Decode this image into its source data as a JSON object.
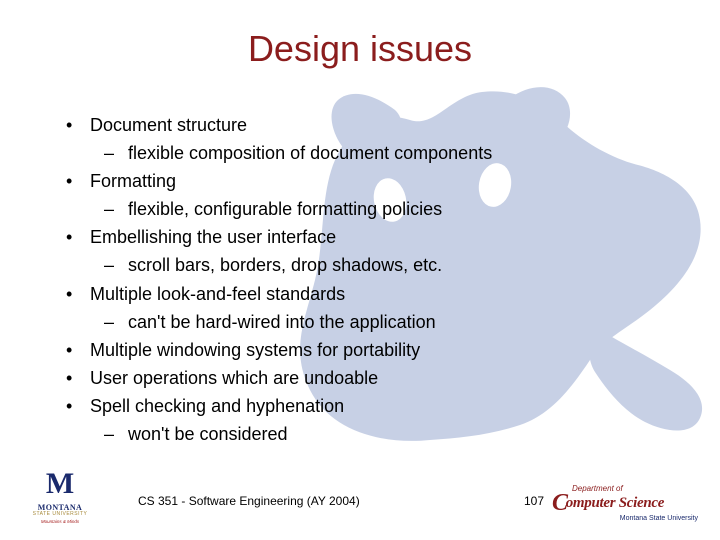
{
  "title": "Design issues",
  "bullets": [
    {
      "level": 1,
      "text": "Document structure"
    },
    {
      "level": 2,
      "text": "flexible composition of document components"
    },
    {
      "level": 1,
      "text": "Formatting"
    },
    {
      "level": 2,
      "text": "flexible, configurable formatting policies"
    },
    {
      "level": 1,
      "text": "Embellishing the user interface"
    },
    {
      "level": 2,
      "text": "scroll bars, borders, drop shadows, etc."
    },
    {
      "level": 1,
      "text": "Multiple look-and-feel standards"
    },
    {
      "level": 2,
      "text": "can't be hard-wired into the application"
    },
    {
      "level": 1,
      "text": "Multiple windowing systems for portability"
    },
    {
      "level": 1,
      "text": "User operations which are undoable"
    },
    {
      "level": 1,
      "text": "Spell checking and hyphenation"
    },
    {
      "level": 2,
      "text": "won't be considered"
    }
  ],
  "footer": {
    "course": "CS 351 - Software Engineering (AY 2004)",
    "page": "107"
  },
  "logo_left": {
    "letter": "M",
    "name": "MONTANA",
    "sub": "STATE UNIVERSITY",
    "tag": "Mountains & Minds"
  },
  "logo_right": {
    "dept": "Department of",
    "c": "C",
    "rest": "omputer Science",
    "sub": "Montana State University"
  }
}
